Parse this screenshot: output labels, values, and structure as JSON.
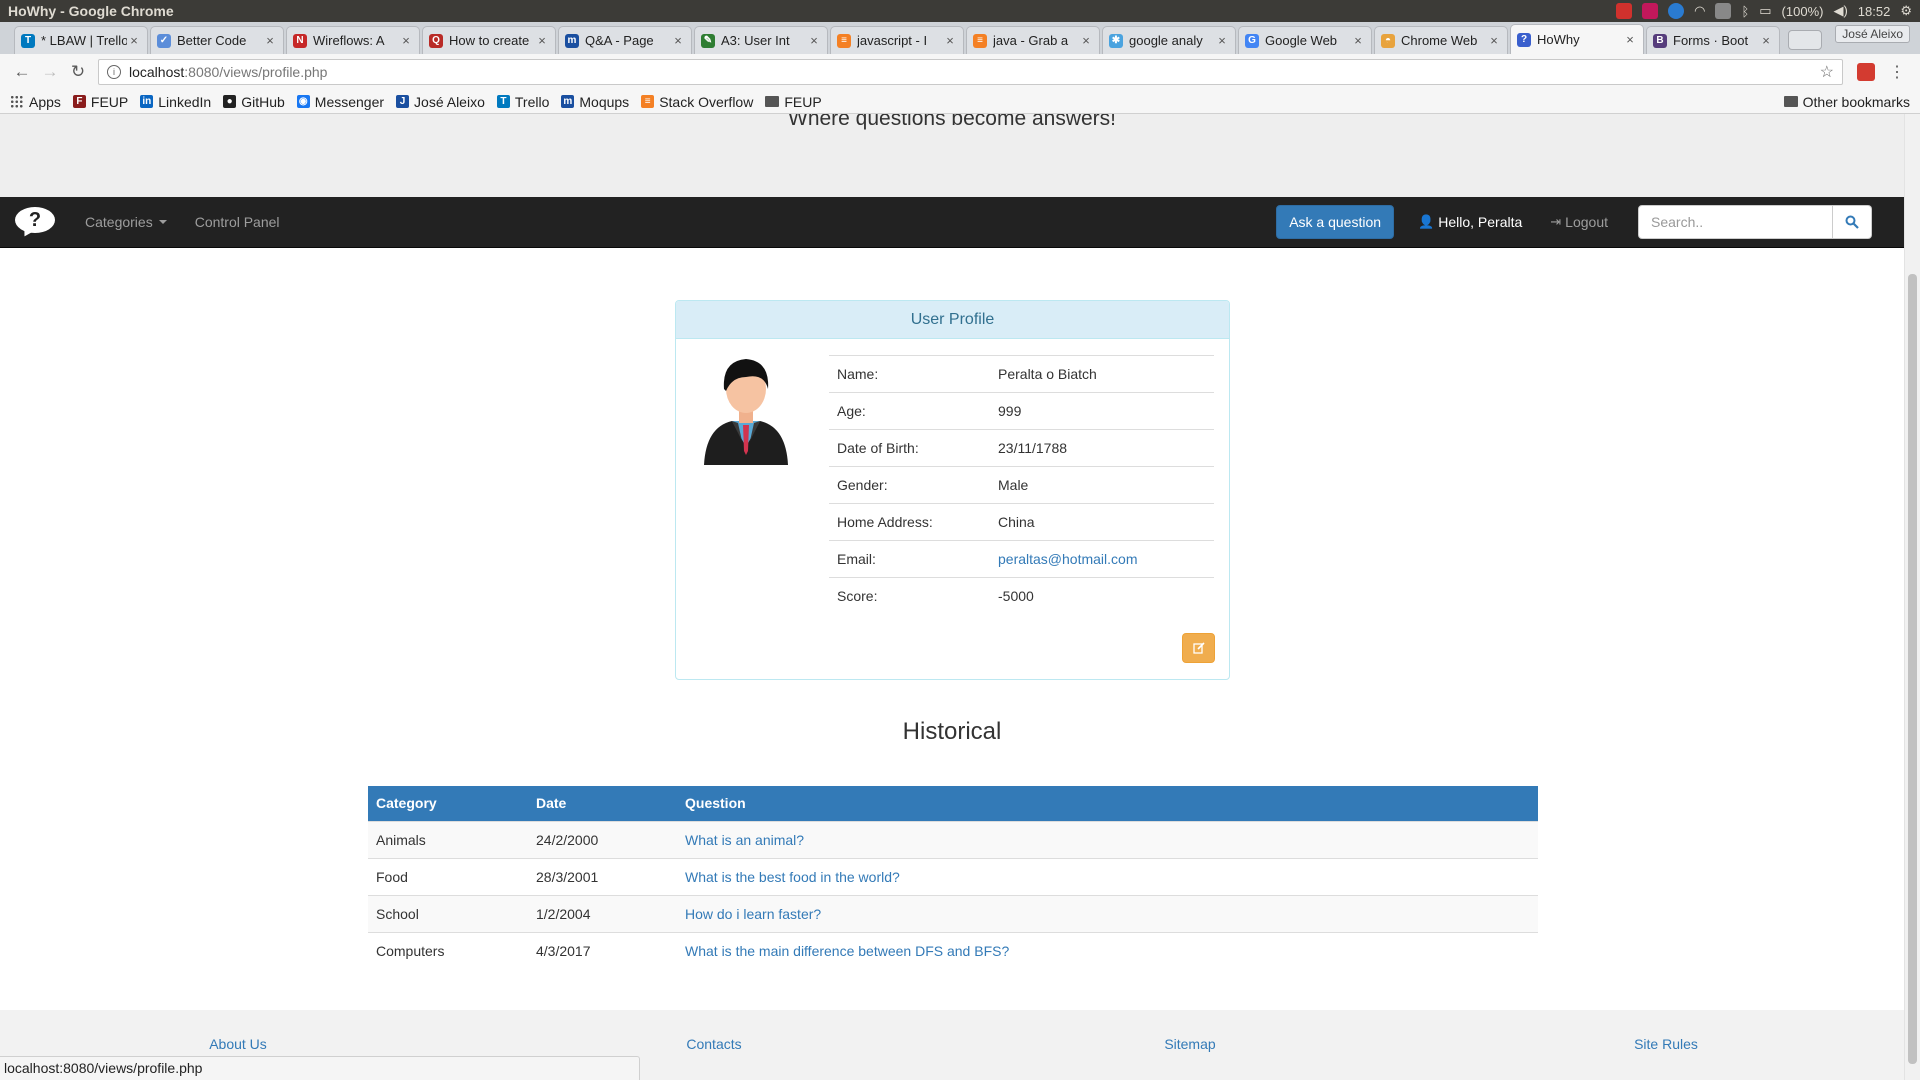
{
  "os": {
    "window_title": "HoWhy - Google Chrome",
    "battery": "(100%)",
    "time": "18:52",
    "user_badge": "José Aleixo"
  },
  "tabs": [
    {
      "title": "* LBAW | Trello",
      "color": "#0079bf",
      "fav": "T"
    },
    {
      "title": "Better Code",
      "color": "#5b8dd9",
      "fav": "✓"
    },
    {
      "title": "Wireflows: A",
      "color": "#c62828",
      "fav": "N"
    },
    {
      "title": "How to create",
      "color": "#b92b27",
      "fav": "Q"
    },
    {
      "title": "Q&A - Page",
      "color": "#1a4fa0",
      "fav": "m"
    },
    {
      "title": "A3: User Int",
      "color": "#2e7d32",
      "fav": "✎"
    },
    {
      "title": "javascript - I",
      "color": "#f48024",
      "fav": "≡"
    },
    {
      "title": "java - Grab a",
      "color": "#f48024",
      "fav": "≡"
    },
    {
      "title": "google analy",
      "color": "#4aa3df",
      "fav": "✱"
    },
    {
      "title": "Google Web",
      "color": "#4285f4",
      "fav": "G"
    },
    {
      "title": "Chrome Web",
      "color": "#e8a33d",
      "fav": "◓"
    },
    {
      "title": "HoWhy",
      "color": "#3a5fcd",
      "fav": "?"
    },
    {
      "title": "Forms · Boot",
      "color": "#563d7c",
      "fav": "B"
    }
  ],
  "address": {
    "host": "localhost",
    "path": ":8080/views/profile.php"
  },
  "bookmarks": [
    {
      "label": "Apps",
      "type": "apps"
    },
    {
      "label": "FEUP",
      "type": "icon",
      "color": "#8a1c1c",
      "fav": "F"
    },
    {
      "label": "LinkedIn",
      "type": "icon",
      "color": "#0a66c2",
      "fav": "in"
    },
    {
      "label": "GitHub",
      "type": "icon",
      "color": "#222222",
      "fav": "●"
    },
    {
      "label": "Messenger",
      "type": "icon",
      "color": "#1877f2",
      "fav": "◉"
    },
    {
      "label": "José Aleixo",
      "type": "icon",
      "color": "#1a4fa0",
      "fav": "J"
    },
    {
      "label": "Trello",
      "type": "icon",
      "color": "#0079bf",
      "fav": "T"
    },
    {
      "label": "Moqups",
      "type": "icon",
      "color": "#1a4fa0",
      "fav": "m"
    },
    {
      "label": "Stack Overflow",
      "type": "icon",
      "color": "#f48024",
      "fav": "≡"
    },
    {
      "label": "FEUP",
      "type": "folder"
    }
  ],
  "other_bookmarks": "Other bookmarks",
  "site": {
    "slogan": "Where questions become answers!",
    "nav": {
      "brand_icon": "question-bubble-icon",
      "categories": "Categories",
      "control_panel": "Control Panel",
      "ask": "Ask a question",
      "hello": "Hello, Peralta",
      "logout": "Logout",
      "search_placeholder": "Search.."
    }
  },
  "profile": {
    "heading": "User Profile",
    "fields": [
      {
        "label": "Name:",
        "value": "Peralta o Biatch"
      },
      {
        "label": "Age:",
        "value": "999"
      },
      {
        "label": "Date of Birth:",
        "value": "23/11/1788"
      },
      {
        "label": "Gender:",
        "value": "Male"
      },
      {
        "label": "Home Address:",
        "value": "China"
      },
      {
        "label": "Email:",
        "value": "peraltas@hotmail.com",
        "link": true
      },
      {
        "label": "Score:",
        "value": "-5000"
      }
    ]
  },
  "historical": {
    "title": "Historical",
    "columns": [
      "Category",
      "Date",
      "Question"
    ],
    "rows": [
      {
        "category": "Animals",
        "date": "24/2/2000",
        "question": "What is an animal?"
      },
      {
        "category": "Food",
        "date": "28/3/2001",
        "question": "What is the best food in the world?"
      },
      {
        "category": "School",
        "date": "1/2/2004",
        "question": "How do i learn faster?"
      },
      {
        "category": "Computers",
        "date": "4/3/2017",
        "question": "What is the main difference between DFS and BFS?"
      }
    ]
  },
  "footer": [
    "About Us",
    "Contacts",
    "Sitemap",
    "Site Rules"
  ],
  "status_url": "localhost:8080/views/profile.php",
  "colors": {
    "navbar": "#222222",
    "primary": "#337ab7",
    "warning": "#f0ad4e",
    "info_bg": "#d9edf7"
  }
}
